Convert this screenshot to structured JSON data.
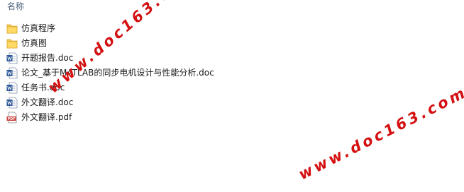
{
  "column_header": {
    "name_label": "名称"
  },
  "files": [
    {
      "type": "folder",
      "name": "仿真程序",
      "icon": "folder-icon"
    },
    {
      "type": "folder",
      "name": "仿真图",
      "icon": "folder-icon"
    },
    {
      "type": "doc",
      "name": "开题报告.doc",
      "icon": "word-doc-icon"
    },
    {
      "type": "doc",
      "name": "论文_基于MATLAB的同步电机设计与性能分析.doc",
      "icon": "word-doc-icon"
    },
    {
      "type": "doc",
      "name": "任务书.doc",
      "icon": "word-doc-icon"
    },
    {
      "type": "doc",
      "name": "外文翻译.doc",
      "icon": "word-doc-icon"
    },
    {
      "type": "pdf",
      "name": "外文翻译.pdf",
      "icon": "pdf-icon"
    }
  ],
  "watermark": {
    "text": "www.doc163.com",
    "color": "#d40f10"
  },
  "colors": {
    "folder_yellow": "#f5c84c",
    "word_blue": "#2b5797",
    "pdf_red": "#c8312b"
  }
}
